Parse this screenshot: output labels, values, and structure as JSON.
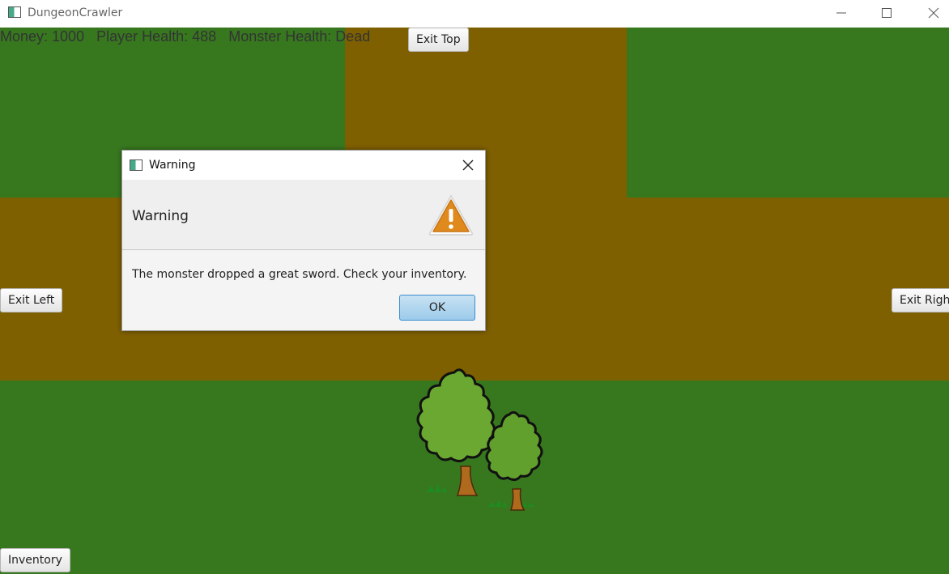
{
  "window": {
    "title": "DungeonCrawler"
  },
  "hud": {
    "money": "Money: 1000",
    "player_health": "Player Health: 488",
    "monster_health": "Monster Health: Dead"
  },
  "buttons": {
    "exit_top": "Exit Top",
    "exit_left": "Exit Left",
    "exit_right": "Exit Right",
    "inventory": "Inventory"
  },
  "dialog": {
    "title": "Warning",
    "header": "Warning",
    "content": "The monster dropped a great sword. Check your inventory.",
    "ok_label": "OK"
  },
  "colors": {
    "grass": "#37781f",
    "path": "#7f6000",
    "warning_icon": "#e08a1e"
  }
}
